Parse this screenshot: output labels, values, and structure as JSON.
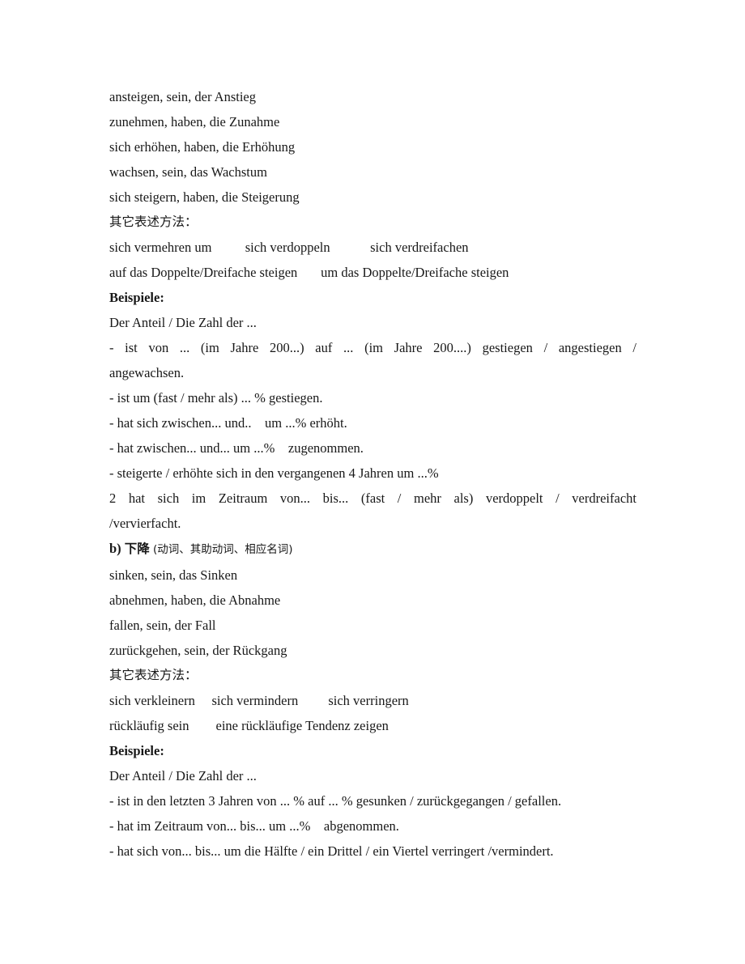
{
  "document": {
    "language_note": "German-Chinese study handout on describing increase and decrease",
    "section_a_vocabulary": [
      "ansteigen, sein, der Anstieg",
      "zunehmen, haben, die Zunahme",
      "sich erhöhen, haben, die Erhöhung",
      "wachsen, sein, das Wachstum",
      "sich steigern, haben, die Steigerung"
    ],
    "section_a_other_heading": "其它表述方法：",
    "section_a_other_expressions": [
      "sich vermehren um          sich verdoppeln            sich verdreifachen",
      "auf das Doppelte/Dreifache steigen       um das Doppelte/Dreifache steigen"
    ],
    "beispiele_label_1": "Beispiele:",
    "section_a_examples_lead": "Der Anteil / Die Zahl der ...",
    "section_a_example_1_justified": "- ist von ... (im Jahre 200...) auf ... (im Jahre 200....) gestiegen / angestiegen /",
    "section_a_example_1_tail": "angewachsen.",
    "section_a_examples": [
      "- ist um (fast / mehr als) ... % gestiegen.",
      "- hat sich zwischen... und..    um ...% erhöht.",
      "- hat zwischen... und... um ...%    zugenommen.",
      "- steigerte / erhöhte sich in den vergangenen 4 Jahren um ...%"
    ],
    "section_a_example_2_justified": "2  hat sich im Zeitraum von... bis... (fast / mehr als) verdoppelt / verdreifacht",
    "section_a_example_2_tail": "/vervierfacht.",
    "section_b_heading_marker": "b)",
    "section_b_heading_cjk": "下降",
    "section_b_heading_note": "(动词、其助动词、相应名词)",
    "section_b_vocabulary": [
      "sinken, sein, das Sinken",
      "abnehmen, haben, die Abnahme",
      "fallen, sein, der Fall",
      "zurückgehen, sein, der Rückgang"
    ],
    "section_b_other_heading": "其它表述方法：",
    "section_b_other_expressions": [
      "sich verkleinern     sich vermindern         sich verringern",
      "rückläufig sein        eine rückläufige Tendenz zeigen"
    ],
    "beispiele_label_2": "Beispiele:",
    "section_b_examples_lead": "Der Anteil / Die Zahl der ...",
    "section_b_examples": [
      "- ist in den letzten 3 Jahren von ... % auf ... % gesunken / zurückgegangen / gefallen.",
      "- hat im Zeitraum von... bis... um ...%    abgenommen.",
      "- hat sich von... bis... um die Hälfte / ein Drittel / ein Viertel verringert /vermindert."
    ]
  },
  "colors": {
    "page_background": "#ffffff",
    "text": "#181818"
  }
}
